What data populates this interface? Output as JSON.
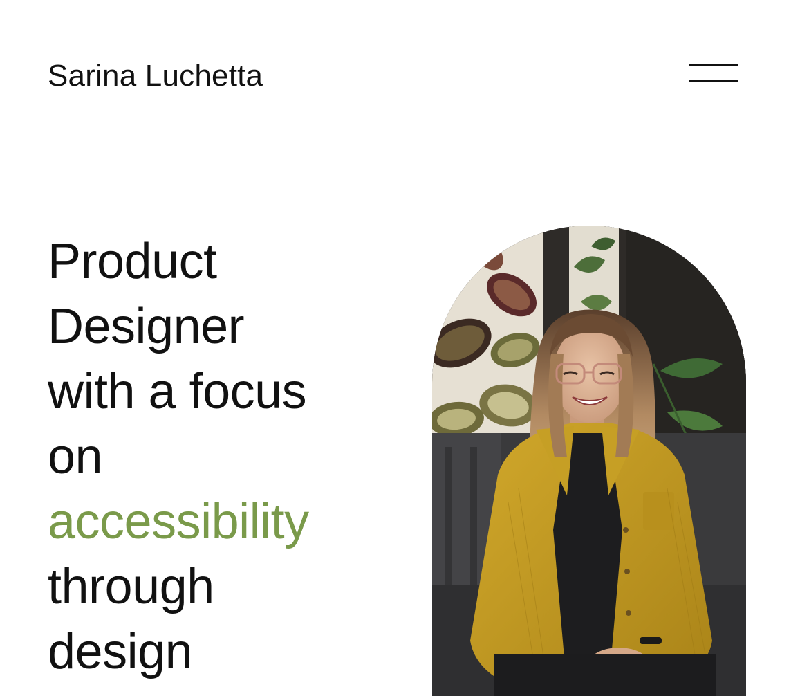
{
  "header": {
    "site_name": "Sarina Luchetta",
    "menu_icon": "hamburger-menu-icon"
  },
  "hero": {
    "headline_lines": [
      "Product",
      "Designer",
      "with a focus",
      "on",
      "accessibility",
      "through",
      "design"
    ],
    "accent_word": "accessibility",
    "accent_color": "#7a9a4a",
    "text_color": "#111111",
    "background_color": "#ffffff"
  },
  "portrait": {
    "shape": "arch",
    "subject": "smiling woman in mustard corduroy jacket seated in dark armchair"
  }
}
